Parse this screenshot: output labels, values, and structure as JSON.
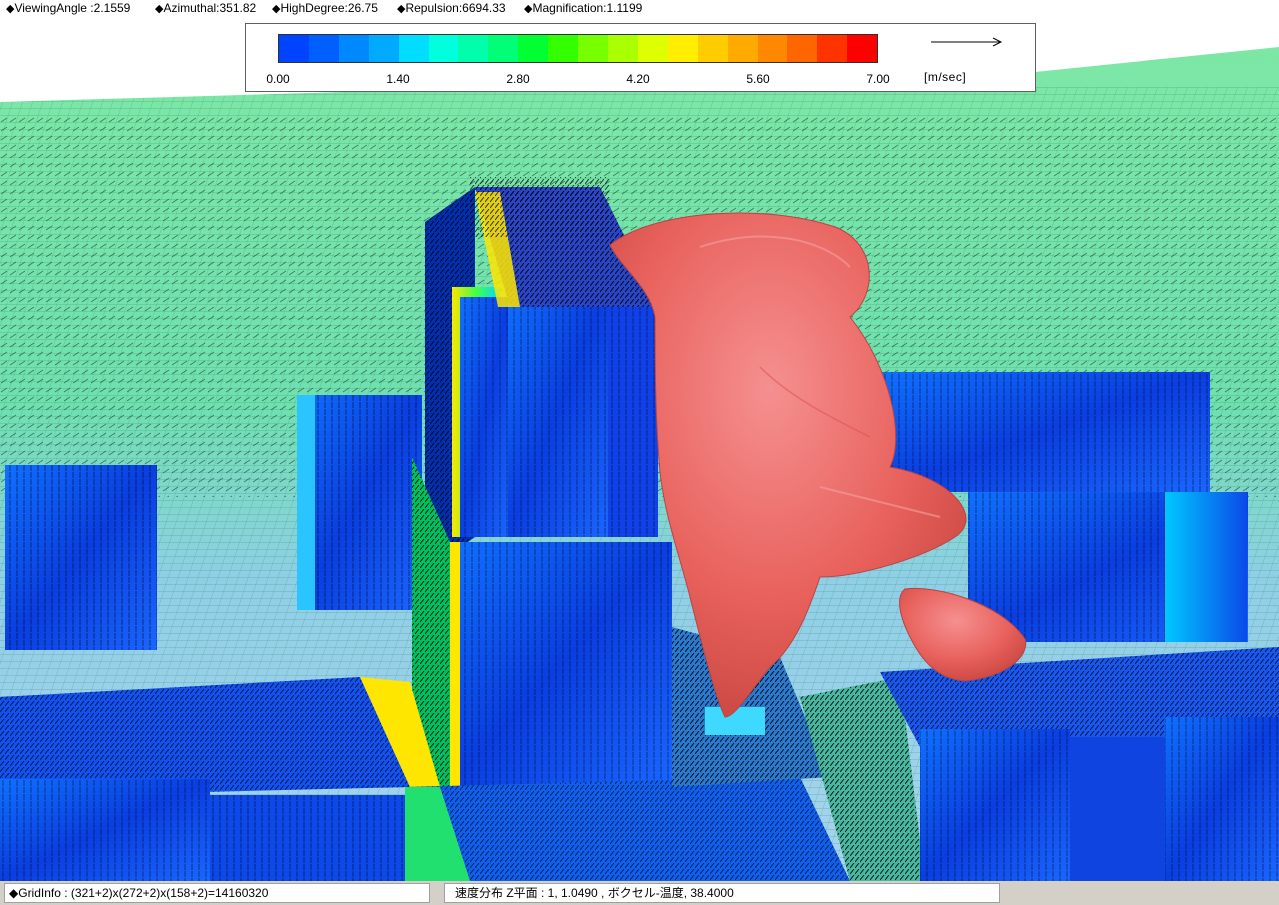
{
  "header": {
    "items": [
      {
        "marker": "◆",
        "text": "ViewingAngle :2.1559"
      },
      {
        "marker": "◆",
        "text": "Azimuthal:351.82"
      },
      {
        "marker": "◆",
        "text": "HighDegree:26.75"
      },
      {
        "marker": "◆",
        "text": "Repulsion:6694.33"
      },
      {
        "marker": "◆",
        "text": "Magnification:1.1199"
      }
    ]
  },
  "legend": {
    "colors": [
      "#0044ff",
      "#0060ff",
      "#0088ff",
      "#00aaff",
      "#00ddff",
      "#00ffdd",
      "#00ffaa",
      "#00ff77",
      "#00ff33",
      "#33ff00",
      "#77ff00",
      "#aaff00",
      "#ddff00",
      "#ffee00",
      "#ffcc00",
      "#ffaa00",
      "#ff8800",
      "#ff6600",
      "#ff3300",
      "#ff0000"
    ],
    "ticks": [
      "0.00",
      "1.40",
      "2.80",
      "4.20",
      "5.60",
      "7.00"
    ],
    "unit": "[m/sec]",
    "reference_arrow": "reference-vector"
  },
  "status": {
    "grid_info": "◆GridInfo : (321+2)x(272+2)x(158+2)=14160320",
    "field_info": "速度分布 Z平面 : 1,  1.0490    ,  ボクセル-温度,  38.4000"
  },
  "scene": {
    "description_colors": {
      "ground": "#7de6a0",
      "building_blue": "#0a3cdc",
      "plume": "#e8615c"
    }
  }
}
